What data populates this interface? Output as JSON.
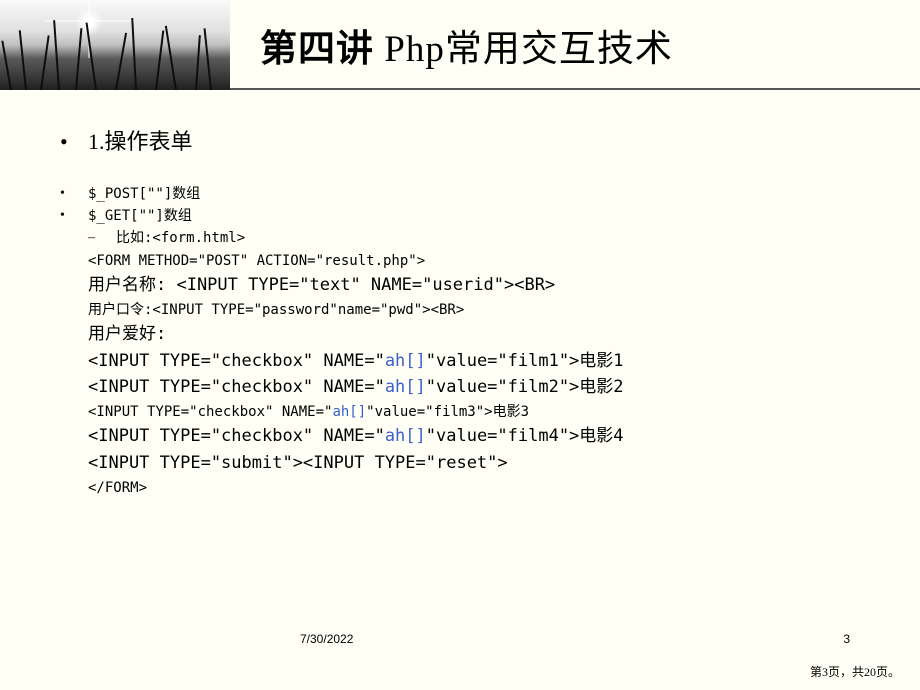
{
  "header": {
    "title_bold": "第四讲",
    "title_rest": " Php常用交互技术"
  },
  "content": {
    "section1": "1.操作表单",
    "post_line": "$_POST[\"\"]数组",
    "get_line": "$_GET[\"\"]数组",
    "example_label": "比如:<form.html>",
    "form_open": "<FORM METHOD=\"POST\" ACTION=\"result.php\">",
    "user_name": "用户名称: <INPUT TYPE=\"text\" NAME=\"userid\"><BR>",
    "user_pwd": "用户口令:<INPUT TYPE=\"password\"name=\"pwd\"><BR>",
    "user_hobby": "用户爱好:",
    "cb1_a": "<INPUT TYPE=\"checkbox\" NAME=\"",
    "cb1_hl": "ah[]",
    "cb1_b": "\"value=\"film1\">电影1",
    "cb2_a": "<INPUT TYPE=\"checkbox\" NAME=\"",
    "cb2_hl": "ah[]",
    "cb2_b": "\"value=\"film2\">电影2",
    "cb3_a": "<INPUT TYPE=\"checkbox\" NAME=\"",
    "cb3_hl": "ah[]",
    "cb3_b": "\"value=\"film3\">电影3",
    "cb4_a": "<INPUT TYPE=\"checkbox\" NAME=\"",
    "cb4_hl": "ah[]",
    "cb4_b": "\"value=\"film4\">电影4",
    "submit_line": "<INPUT TYPE=\"submit\"><INPUT TYPE=\"reset\">",
    "form_close": "</FORM>"
  },
  "footer": {
    "date": "7/30/2022",
    "slide_num": "3",
    "page_info": "第3页，共20页。"
  }
}
